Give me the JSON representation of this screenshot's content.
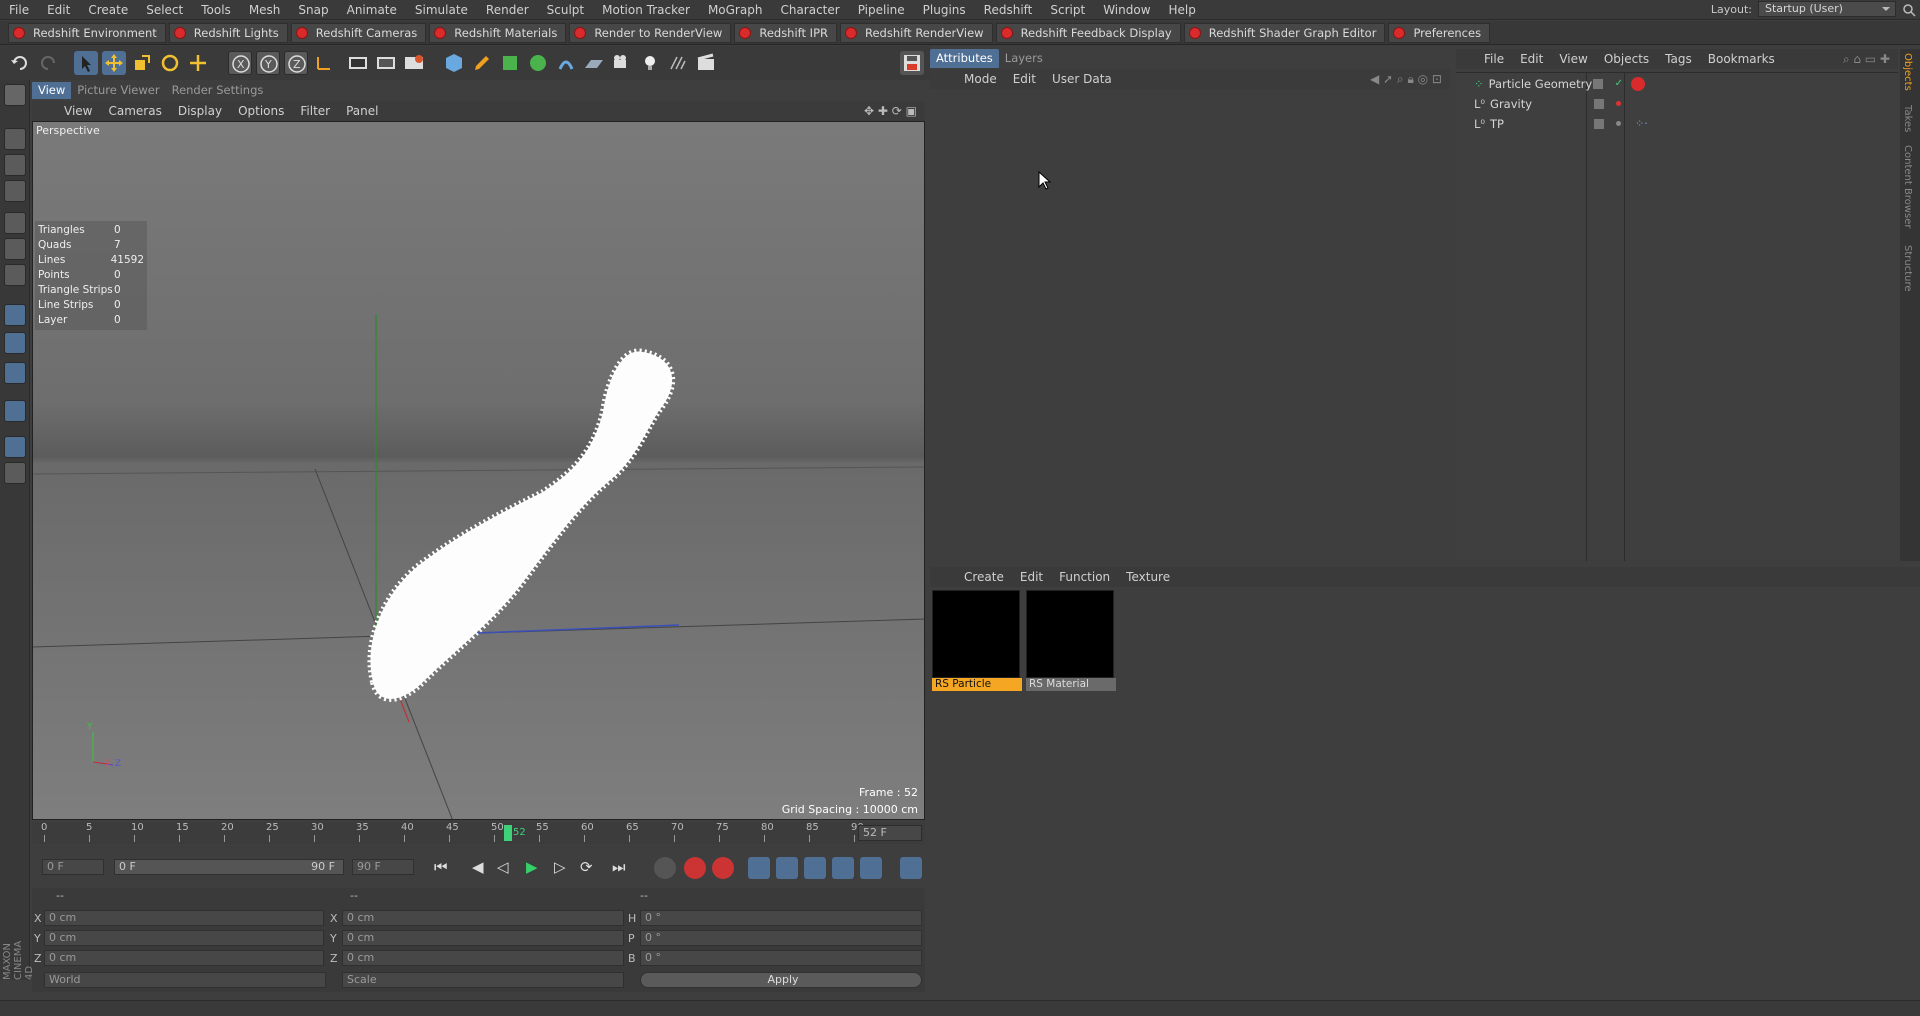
{
  "menubar": {
    "items": [
      "File",
      "Edit",
      "Create",
      "Select",
      "Tools",
      "Mesh",
      "Snap",
      "Animate",
      "Simulate",
      "Render",
      "Sculpt",
      "Motion Tracker",
      "MoGraph",
      "Character",
      "Pipeline",
      "Plugins",
      "Redshift",
      "Script",
      "Window",
      "Help"
    ],
    "layout_label": "Layout:",
    "layout_value": "Startup (User)"
  },
  "redshift_bar": {
    "buttons": [
      "Redshift Environment",
      "Redshift Lights",
      "Redshift Cameras",
      "Redshift Materials",
      "Render to RenderView",
      "Redshift IPR",
      "Redshift RenderView",
      "Redshift Feedback Display",
      "Redshift Shader Graph Editor",
      "Preferences"
    ]
  },
  "viewport": {
    "tabs": [
      "View",
      "Picture Viewer",
      "Render Settings"
    ],
    "menu": [
      "View",
      "Cameras",
      "Display",
      "Options",
      "Filter",
      "Panel"
    ],
    "label": "Perspective",
    "stats": [
      {
        "k": "Triangles",
        "v": "0"
      },
      {
        "k": "Quads",
        "v": "7"
      },
      {
        "k": "Lines",
        "v": "41592"
      },
      {
        "k": "Points",
        "v": "0"
      },
      {
        "k": "Triangle Strips",
        "v": "0"
      },
      {
        "k": "Line Strips",
        "v": "0"
      },
      {
        "k": "Layer",
        "v": "0"
      }
    ],
    "frame_text": "Frame : 52",
    "grid_text": "Grid Spacing : 10000 cm",
    "axis_y": "Y",
    "axis_x": "X",
    "axis_z": "Z"
  },
  "timeline": {
    "ticks": [
      "0",
      "5",
      "10",
      "15",
      "20",
      "25",
      "30",
      "35",
      "40",
      "45",
      "50",
      "55",
      "60",
      "65",
      "70",
      "75",
      "80",
      "85",
      "90"
    ],
    "current_frame": "52",
    "current_field": "52 F",
    "start_field": "0 F",
    "range_start": "0 F",
    "range_end": "90 F",
    "end_field": "90 F"
  },
  "coords": {
    "header_a": "--",
    "header_b": "--",
    "header_c": "--",
    "pos": [
      {
        "l": "X",
        "v": "0 cm"
      },
      {
        "l": "Y",
        "v": "0 cm"
      },
      {
        "l": "Z",
        "v": "0 cm"
      }
    ],
    "size": [
      {
        "l": "X",
        "v": "0 cm"
      },
      {
        "l": "Y",
        "v": "0 cm"
      },
      {
        "l": "Z",
        "v": "0 cm"
      }
    ],
    "rot": [
      {
        "l": "H",
        "v": "0 °"
      },
      {
        "l": "P",
        "v": "0 °"
      },
      {
        "l": "B",
        "v": "0 °"
      }
    ],
    "world_select": "World",
    "scale_select": "Scale",
    "apply_label": "Apply"
  },
  "attributes": {
    "tabs": [
      "Attributes",
      "Layers"
    ],
    "menu": [
      "Mode",
      "Edit",
      "User Data"
    ]
  },
  "objects": {
    "menu": [
      "File",
      "Edit",
      "View",
      "Objects",
      "Tags",
      "Bookmarks"
    ],
    "rows": [
      "Particle Geometry",
      "Gravity",
      "TP"
    ],
    "side_tabs": [
      "Objects",
      "Takes",
      "Content Browser",
      "Structure"
    ]
  },
  "materials": {
    "menu": [
      "Create",
      "Edit",
      "Function",
      "Texture"
    ],
    "items": [
      {
        "name": "RS Particle",
        "selected": true
      },
      {
        "name": "RS Material",
        "selected": false
      }
    ]
  },
  "brand": "MAXON CINEMA 4D",
  "colors": {
    "accent": "#4f6f95",
    "selected_material": "#f5a623",
    "redshift": "#d92b2b"
  }
}
